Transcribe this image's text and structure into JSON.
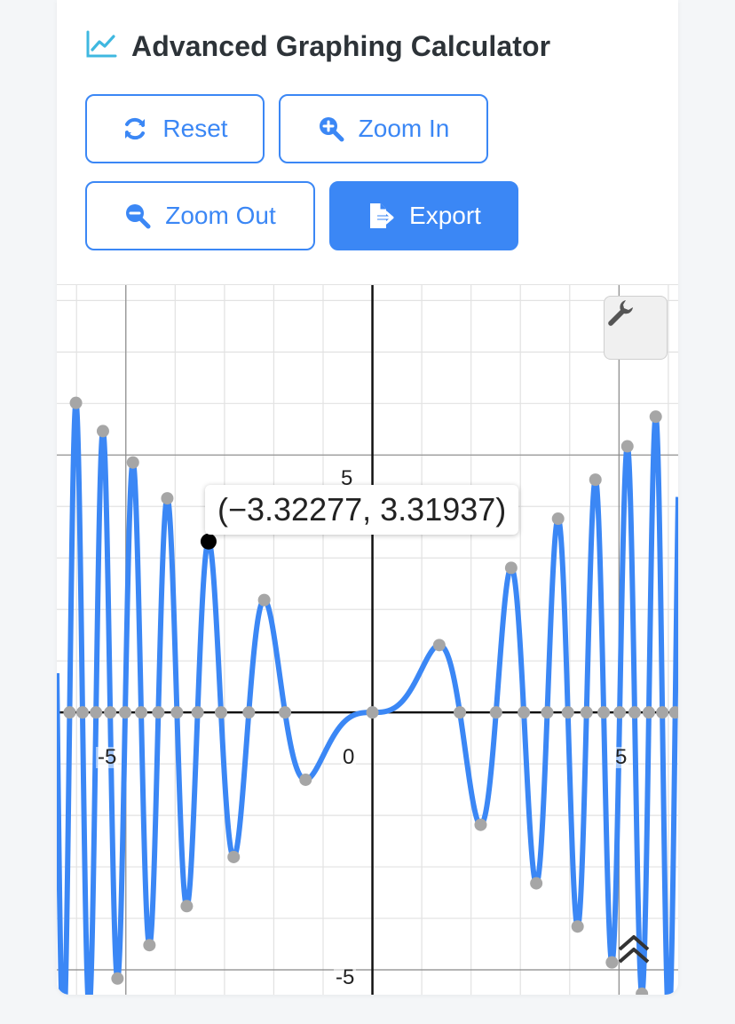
{
  "app": {
    "title": "Advanced Graphing Calculator",
    "icon": "chart-line-icon",
    "accent_color": "#3b87f5"
  },
  "toolbar": {
    "reset_label": "Reset",
    "zoom_in_label": "Zoom In",
    "zoom_out_label": "Zoom Out",
    "export_label": "Export"
  },
  "graph": {
    "tooltip": "(−3.32277, 3.31937)",
    "settings_icon": "wrench-icon",
    "collapse_icon": "double-chevron-up-icon",
    "curve_color": "#3b87f5",
    "point_color": "#a6a6a6",
    "selected_point_color": "#000000"
  },
  "chart_data": {
    "type": "line",
    "function_points": "y = x·sin(x²)",
    "x_range": [
      -6.4,
      6.2
    ],
    "y_range": [
      -5.5,
      8.3
    ],
    "grid": true,
    "tick_labels": {
      "x_neg": "-5",
      "origin": "0",
      "x_pos": "5",
      "y_pos": "5",
      "y_neg": "-5"
    },
    "selected_point": {
      "x": -3.32277,
      "y": 3.31937
    }
  }
}
